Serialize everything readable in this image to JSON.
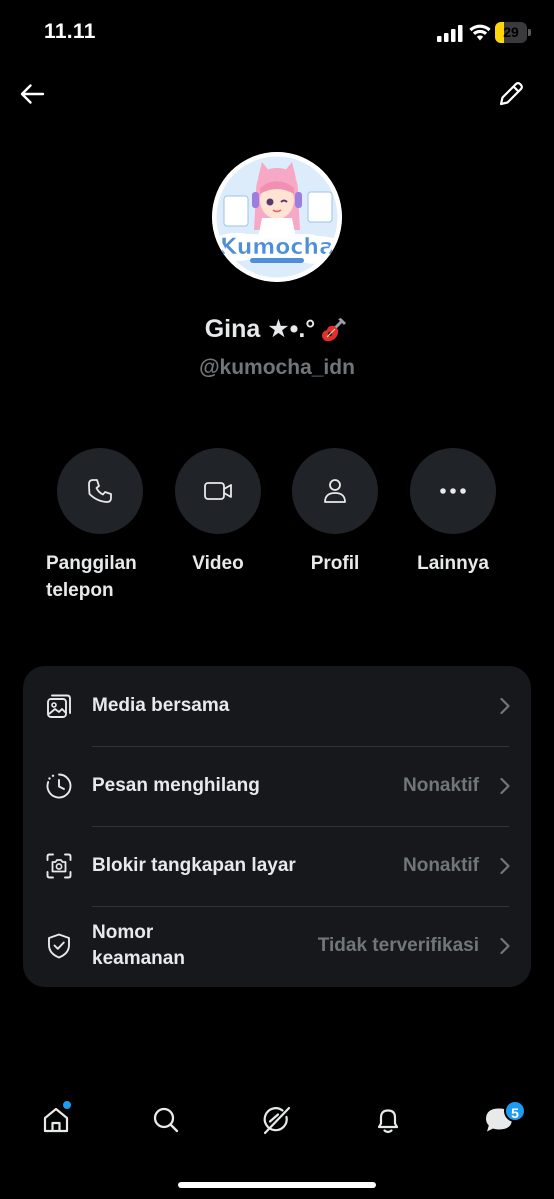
{
  "status_bar": {
    "time": "11.11",
    "battery_level": "29",
    "battery_fraction": 0.29
  },
  "header": {
    "back_icon": "arrow-left-icon",
    "edit_icon": "pencil-icon"
  },
  "profile": {
    "avatar_text": "Kumocha",
    "name": "Gina ★•.°",
    "name_emoji_icon": "guitar-icon",
    "handle": "@kumocha_idn"
  },
  "actions": [
    {
      "label": "Panggilan telepon",
      "line1": "Panggilan",
      "line2": "telepon",
      "icon": "phone-icon"
    },
    {
      "label": "Video",
      "icon": "video-camera-icon"
    },
    {
      "label": "Profil",
      "icon": "person-icon"
    },
    {
      "label": "Lainnya",
      "icon": "more-dots-icon"
    }
  ],
  "settings": [
    {
      "label": "Media bersama",
      "value": "",
      "icon": "shared-media-icon"
    },
    {
      "label": "Pesan menghilang",
      "value": "Nonaktif",
      "icon": "timer-icon"
    },
    {
      "label": "Blokir tangkapan layar",
      "value": "Nonaktif",
      "icon": "screenshot-camera-icon"
    },
    {
      "label": "Nomor keamanan",
      "line1": "Nomor",
      "line2": "keamanan",
      "value": "Tidak terverifikasi",
      "icon": "shield-check-icon"
    }
  ],
  "bottom_nav": {
    "items": [
      "home-icon",
      "search-icon",
      "grok-icon",
      "bell-icon",
      "messages-icon"
    ],
    "messages_badge": "5"
  },
  "colors": {
    "background": "#000000",
    "card": "#16181c",
    "circle": "#202327",
    "text_primary": "#e7e9ea",
    "text_secondary": "#71767b",
    "accent": "#1d9bf0",
    "battery": "#ffd60a"
  }
}
